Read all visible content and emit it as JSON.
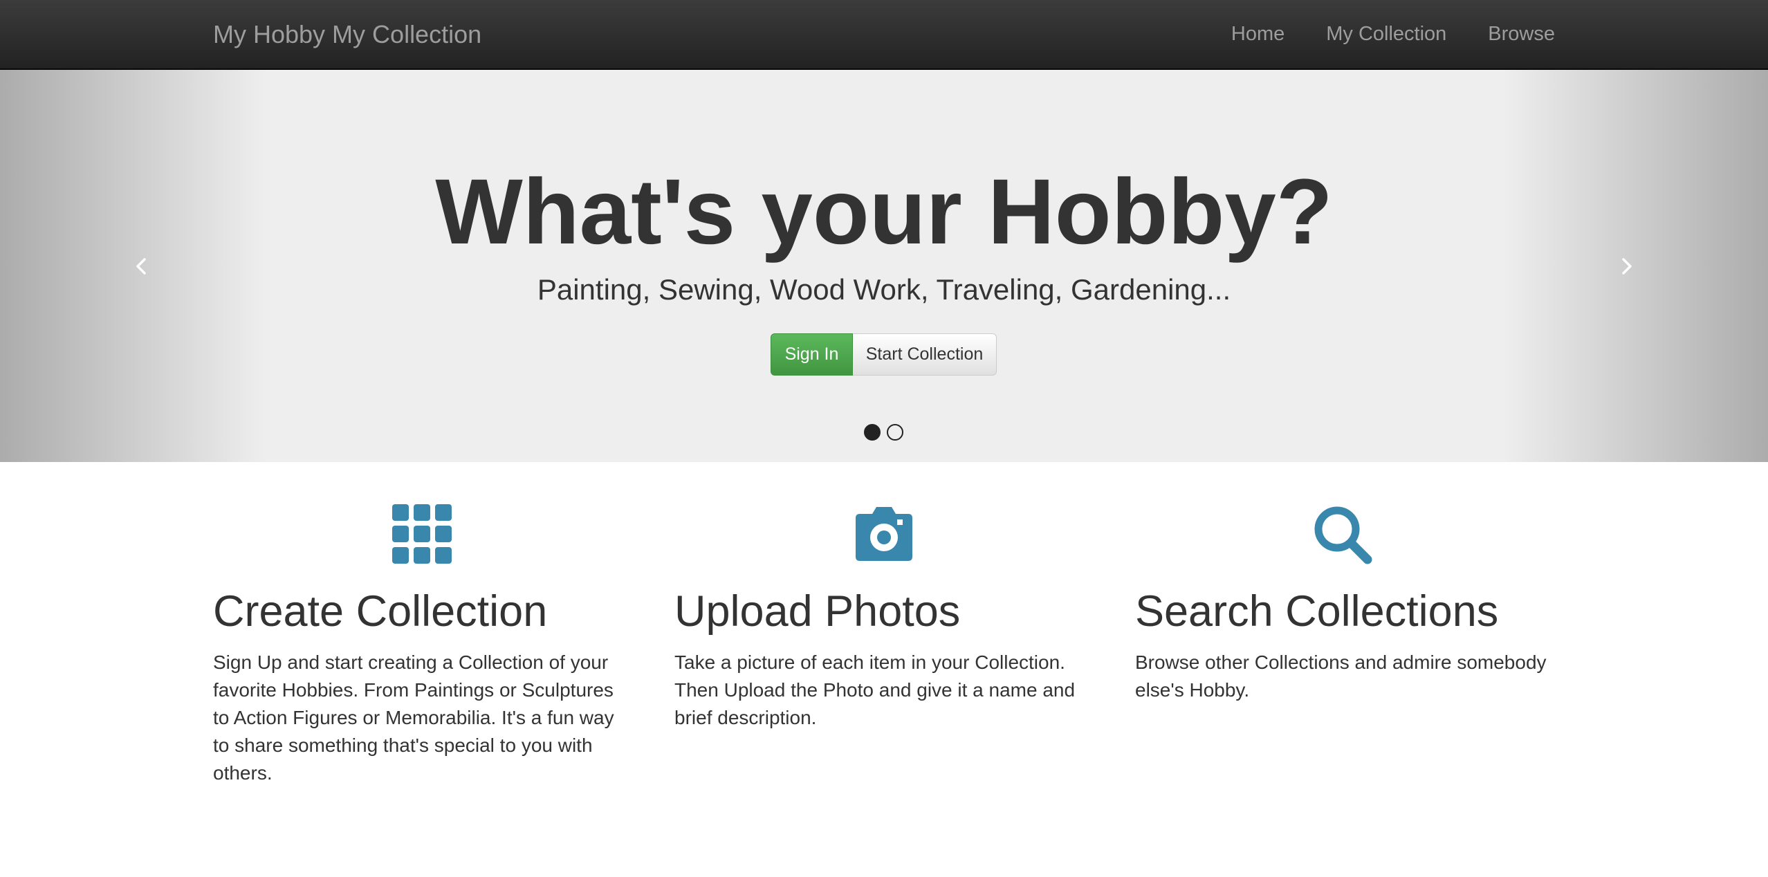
{
  "navbar": {
    "brand": "My Hobby My Collection",
    "items": [
      {
        "label": "Home"
      },
      {
        "label": "My Collection"
      },
      {
        "label": "Browse"
      }
    ]
  },
  "hero": {
    "title": "What's your Hobby?",
    "subtitle": "Painting, Sewing, Wood Work, Traveling, Gardening...",
    "sign_in_label": "Sign In",
    "start_collection_label": "Start Collection",
    "slide_count": 2,
    "active_slide": 1
  },
  "features": [
    {
      "icon": "grid-icon",
      "title": "Create Collection",
      "text": "Sign Up and start creating a Collection of your favorite Hobbies. From Paintings or Sculptures to Action Figures or Memorabilia. It's a fun way to share something that's special to you with others."
    },
    {
      "icon": "camera-icon",
      "title": "Upload Photos",
      "text": "Take a picture of each item in your Collection. Then Upload the Photo and give it a name and brief description."
    },
    {
      "icon": "search-icon",
      "title": "Search Collections",
      "text": "Browse other Collections and admire somebody else's Hobby."
    }
  ],
  "colors": {
    "navbar_text": "#9d9d9d",
    "icon_blue": "#3a87ad",
    "success_green": "#5cb85c",
    "text": "#333333"
  }
}
